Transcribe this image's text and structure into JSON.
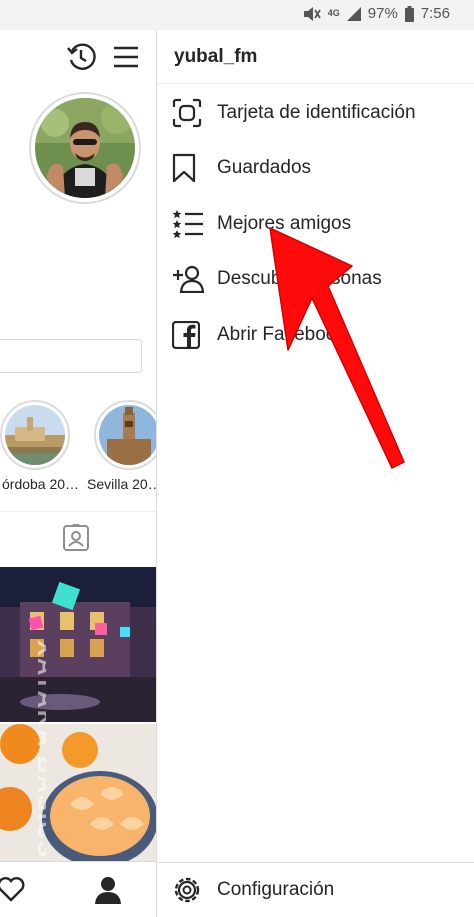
{
  "status_bar": {
    "network": "4G",
    "battery": "97%",
    "time": "7:56"
  },
  "profile": {
    "highlights": [
      {
        "label": "órdoba 20…"
      },
      {
        "label": "Sevilla 20…"
      }
    ]
  },
  "drawer": {
    "username": "yubal_fm",
    "menu": [
      {
        "label": "Tarjeta de identificación",
        "icon": "nametag-icon"
      },
      {
        "label": "Guardados",
        "icon": "bookmark-icon"
      },
      {
        "label": "Mejores amigos",
        "icon": "close-friends-icon"
      },
      {
        "label": "Descubrir personas",
        "icon": "add-person-icon"
      },
      {
        "label": "Abrir Facebook",
        "icon": "facebook-icon"
      }
    ],
    "settings_label": "Configuración"
  },
  "watermark": "XATAKA BASICS",
  "colors": {
    "annotation_arrow": "#ff0a0a",
    "divider": "#dbdbdb",
    "text": "#262626"
  }
}
